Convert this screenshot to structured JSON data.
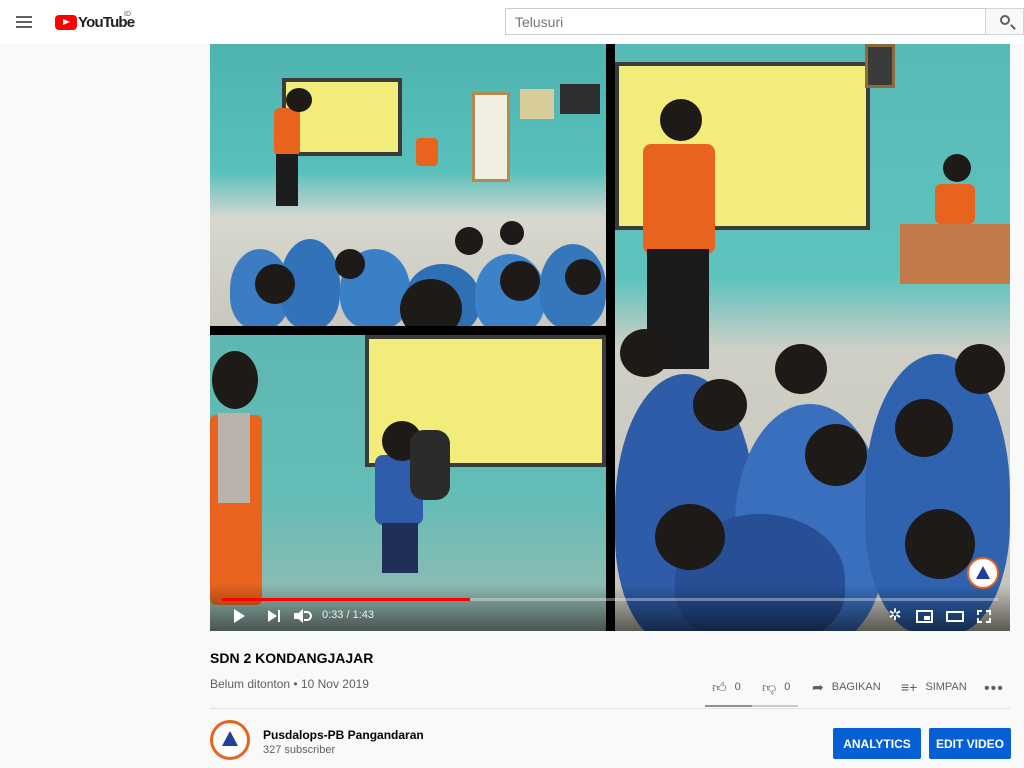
{
  "masthead": {
    "logo_text": "YouTube",
    "country_code": "ID",
    "search_placeholder": "Telusuri"
  },
  "player": {
    "current_time": "0:33",
    "duration": "1:43",
    "time_display": "0:33 / 1:43",
    "progress_fraction": 0.32
  },
  "video": {
    "title": "SDN 2 KONDANGJAJAR",
    "meta": "Belum ditonton • 10 Nov 2019",
    "likes": "0",
    "dislikes": "0",
    "share_label": "BAGIKAN",
    "save_label": "SIMPAN"
  },
  "channel": {
    "name": "Pusdalops-PB Pangandaran",
    "subscribers": "327 subscriber",
    "analytics_label": "ANALYTICS",
    "edit_label": "EDIT VIDEO"
  },
  "colors": {
    "accent": "#065fd4",
    "brand": "#ff0000"
  },
  "icons": [
    "menu-icon",
    "youtube-logo-icon",
    "search-icon",
    "play-icon",
    "next-icon",
    "volume-icon",
    "settings-icon",
    "miniplayer-icon",
    "theater-icon",
    "fullscreen-icon",
    "like-icon",
    "dislike-icon",
    "share-icon",
    "save-icon",
    "more-icon"
  ]
}
